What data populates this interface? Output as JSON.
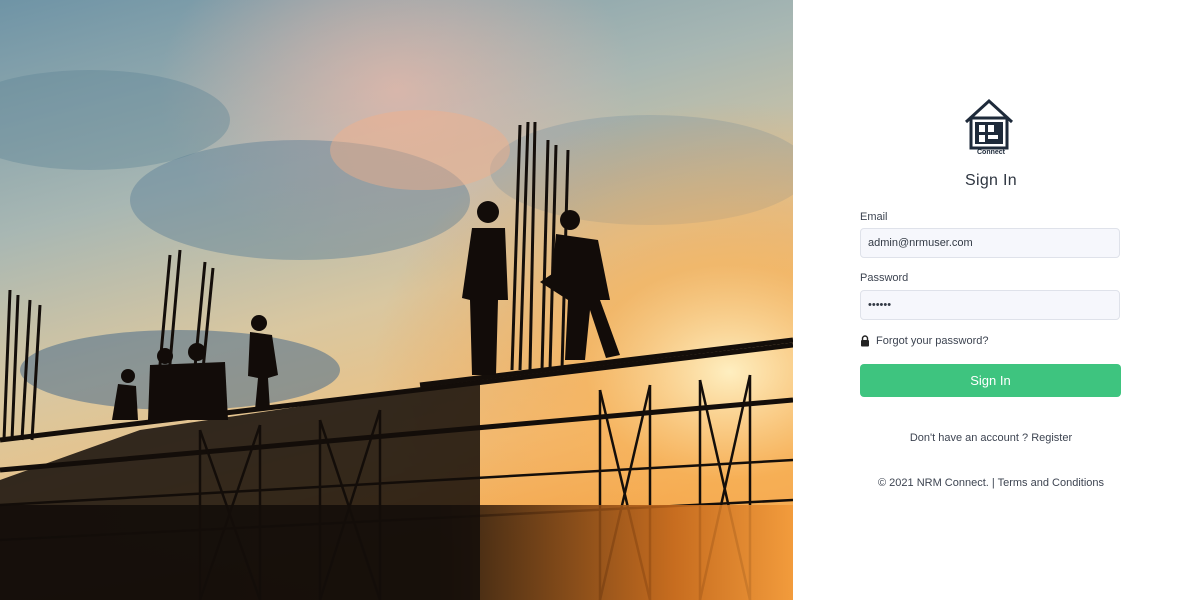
{
  "hero": {
    "image": "construction-workers-silhouette-sunset"
  },
  "brand": {
    "logo_icon": "house-logo-icon",
    "logo_text": "Connect"
  },
  "form": {
    "title": "Sign In",
    "email_label": "Email",
    "email_value": "admin@nrmuser.com",
    "password_label": "Password",
    "password_value": "123456",
    "forgot_label": "Forgot your password?",
    "submit_label": "Sign In"
  },
  "register": {
    "prompt": "Don't have an account ?",
    "link": "Register"
  },
  "footer": {
    "copyright": "© 2021 NRM Connect.",
    "separator": "|",
    "terms": "Terms and Conditions"
  },
  "colors": {
    "accent": "#3ec47f",
    "input_bg": "#f6f7fc",
    "text": "#3d4451"
  }
}
